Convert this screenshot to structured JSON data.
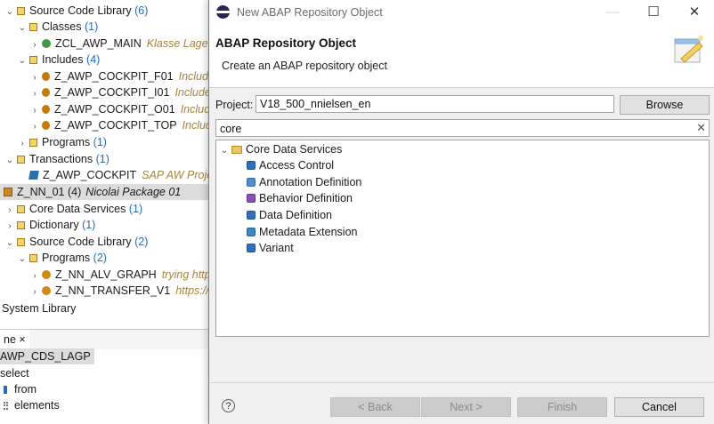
{
  "background": {
    "tree": [
      {
        "label": "Source Code Library",
        "count": "(6)"
      },
      {
        "label": "Classes",
        "count": "(1)"
      },
      {
        "label": "ZCL_AWP_MAIN",
        "desc": "Klasse Lagercc"
      },
      {
        "label": "Includes",
        "count": "(4)"
      },
      {
        "label": "Z_AWP_COCKPIT_F01",
        "desc": "Include Z"
      },
      {
        "label": "Z_AWP_COCKPIT_I01",
        "desc": "Include Z"
      },
      {
        "label": "Z_AWP_COCKPIT_O01",
        "desc": "Include Z"
      },
      {
        "label": "Z_AWP_COCKPIT_TOP",
        "desc": "Include Z"
      },
      {
        "label": "Programs",
        "count": "(1)"
      },
      {
        "label": "Transactions",
        "count": "(1)"
      },
      {
        "label": "Z_AWP_COCKPIT",
        "desc": "SAP AW Project -"
      },
      {
        "label": "Z_NN_01 (4)",
        "desc": "Nicolai Package 01"
      },
      {
        "label": "Core Data Services",
        "count": "(1)"
      },
      {
        "label": "Dictionary",
        "count": "(1)"
      },
      {
        "label": "Source Code Library",
        "count": "(2)"
      },
      {
        "label": "Programs",
        "count": "(2)"
      },
      {
        "label": "Z_NN_ALV_GRAPH",
        "desc": "trying https:"
      },
      {
        "label": "Z_NN_TRANSFER_V1",
        "desc": "https://blc"
      },
      {
        "label": "System Library"
      }
    ],
    "outline_tab": "ne ×",
    "outline_items": [
      "AWP_CDS_LAGP",
      "select",
      "from",
      "elements"
    ]
  },
  "dialog": {
    "window_title": "New ABAP Repository Object",
    "banner_title": "ABAP Repository Object",
    "banner_subtitle": "Create an ABAP repository object",
    "project_label": "Project:",
    "project_value": "V18_500_nnielsen_en",
    "browse_label": "Browse",
    "search_value": "core",
    "tree": {
      "root": "Core Data Services",
      "items": [
        {
          "label": "Access Control",
          "color": "#2f6fbf"
        },
        {
          "label": "Annotation Definition",
          "color": "#4c8fd6"
        },
        {
          "label": "Behavior Definition",
          "color": "#8a4fb8"
        },
        {
          "label": "Data Definition",
          "color": "#2f6fbf"
        },
        {
          "label": "Metadata Extension",
          "color": "#3a86c8"
        },
        {
          "label": "Variant",
          "color": "#2f6fbf"
        }
      ]
    },
    "buttons": {
      "back": "< Back",
      "next": "Next >",
      "finish": "Finish",
      "cancel": "Cancel"
    },
    "help": "?"
  }
}
